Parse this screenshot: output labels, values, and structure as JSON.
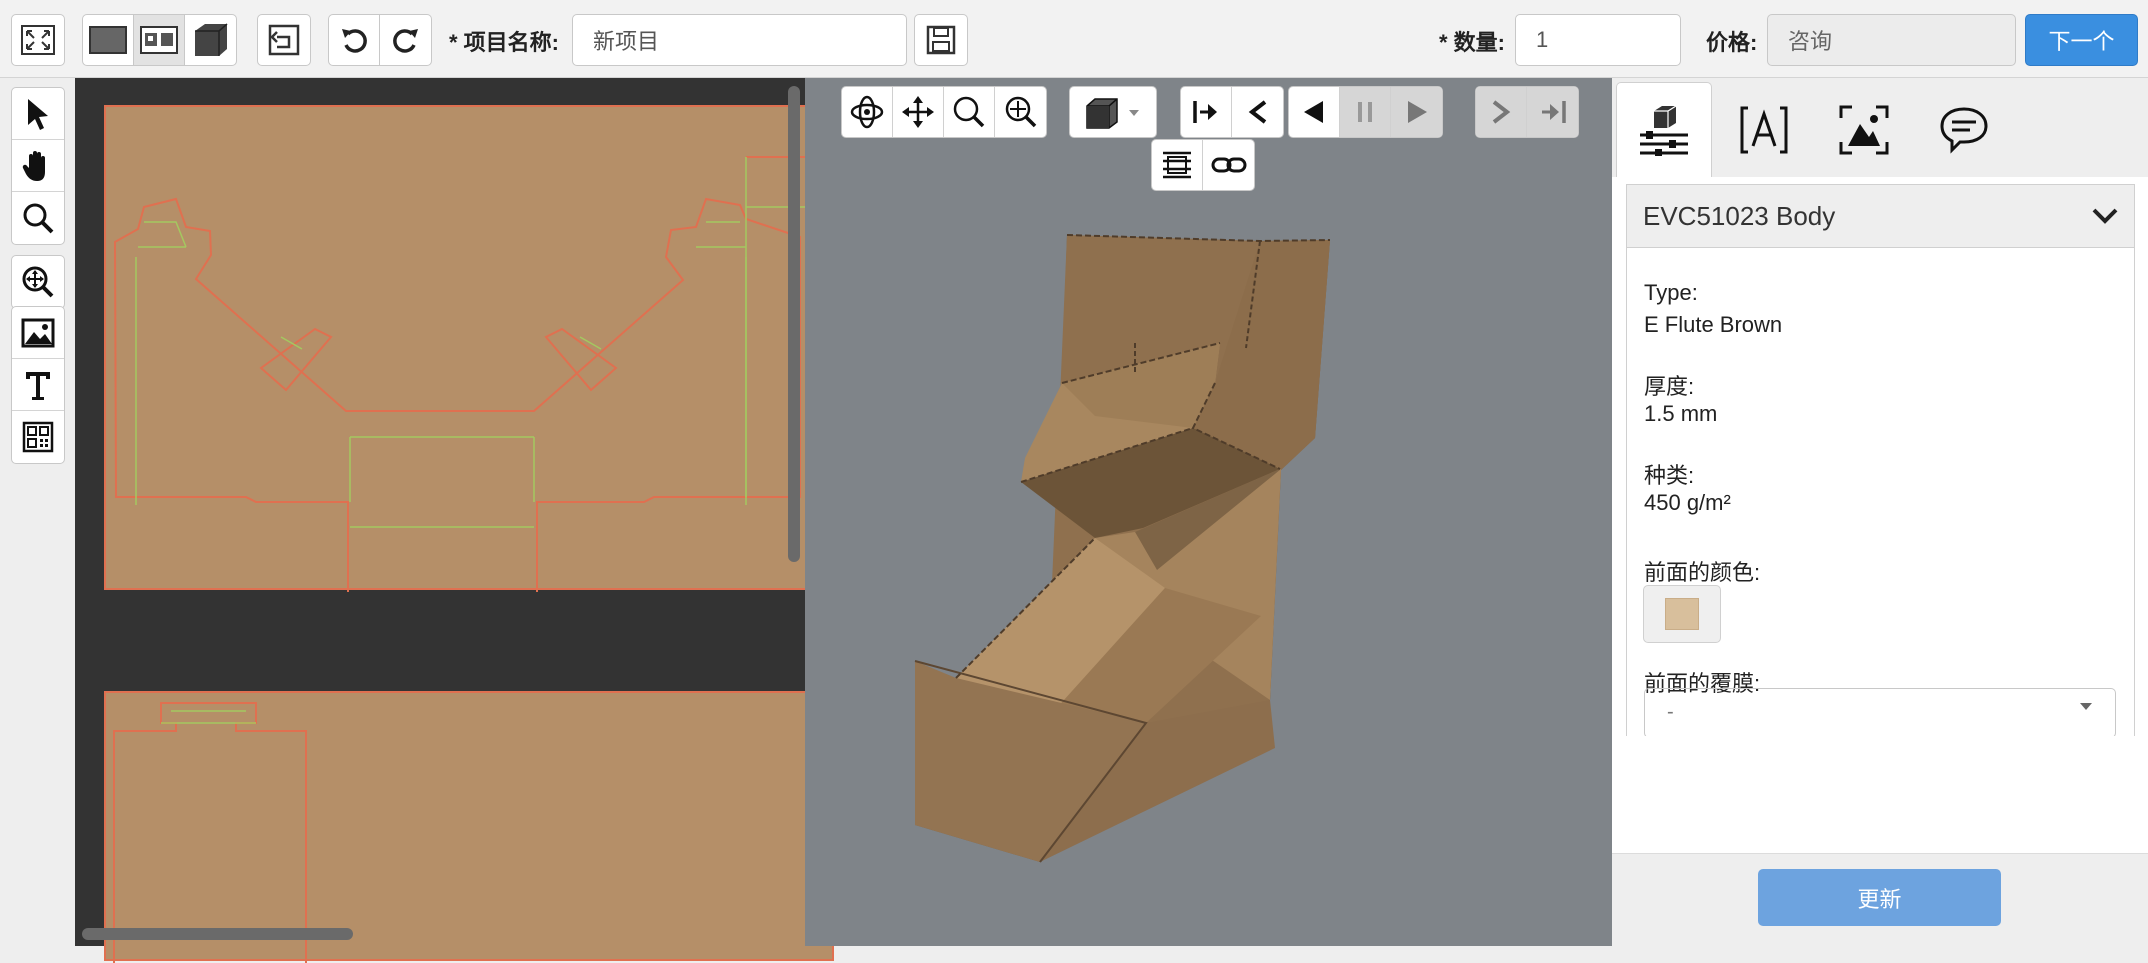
{
  "topbar": {
    "project_name_label": "* 项目名称:",
    "project_name_value": "新项目",
    "quantity_label": "* 数量:",
    "quantity_value": "1",
    "price_label": "价格:",
    "price_value": "咨询",
    "next_button": "下一个"
  },
  "panel": {
    "accordion_title": "EVC51023 Body",
    "properties": [
      {
        "label": "Type:",
        "value": "E Flute Brown"
      },
      {
        "label": "厚度:",
        "value": "1.5 mm"
      },
      {
        "label": "种类:",
        "value": "450 g/m²"
      }
    ],
    "front_color_label": "前面的颜色:",
    "front_color": "#d8bf9c",
    "front_laminate_label": "前面的覆膜:",
    "front_laminate_value": "-",
    "update_button": "更新"
  },
  "colors": {
    "accent": "#3a8fe0",
    "cardboard": "#b58f68",
    "cut_line": "#e07050",
    "fold_line": "#a4c860",
    "viewport": "#7f8489"
  }
}
